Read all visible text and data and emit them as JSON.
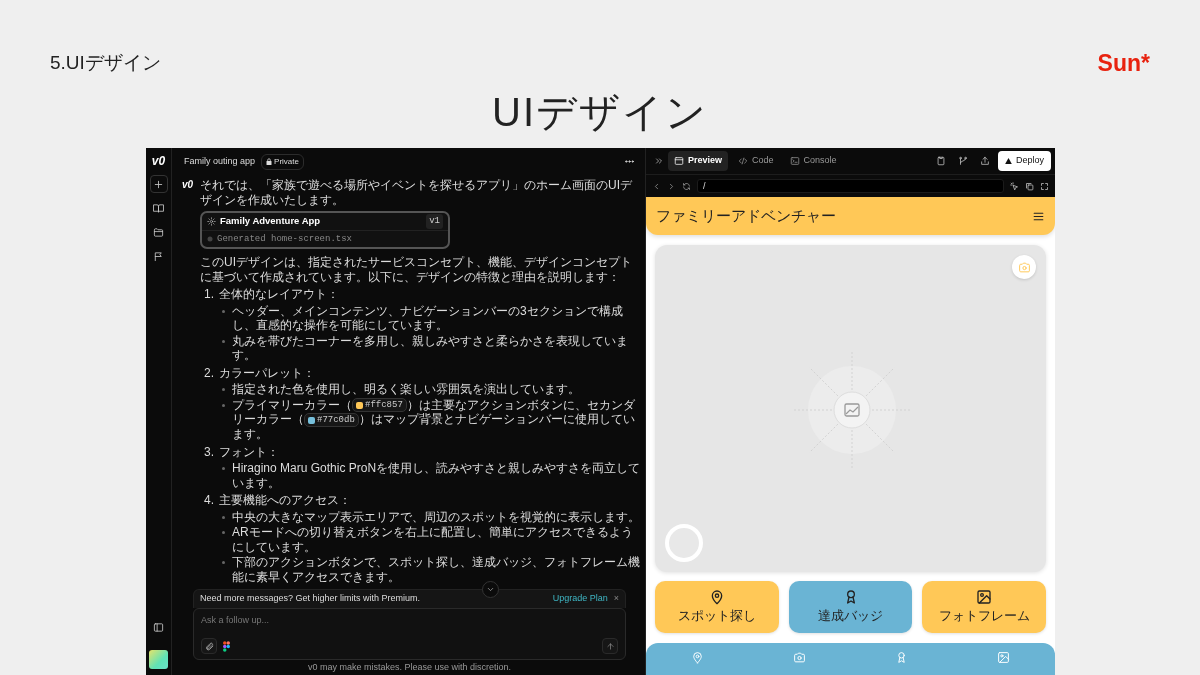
{
  "slide": {
    "section_label": "5.UIデザイン",
    "brand": "Sun*",
    "title": "UIデザイン"
  },
  "chat": {
    "logo": "v0",
    "title": "Family outing app",
    "visibility": "Private",
    "assistant_logo": "v0",
    "intro": "それでは、「家族で遊べる場所やイベントを探せるアプリ」のホーム画面のUIデザインを作成いたします。",
    "artifact": {
      "title": "Family Adventure App",
      "version": "v1",
      "status": "Generated home-screen.tsx"
    },
    "summary": "このUIデザインは、指定されたサービスコンセプト、機能、デザインコンセプトに基づいて作成されています。以下に、デザインの特徴と理由を説明します：",
    "sections": [
      {
        "number": "1.",
        "title": "全体的なレイアウト：",
        "bullets": [
          "ヘッダー、メインコンテンツ、ナビゲーションバーの3セクションで構成し、直感的な操作を可能にしています。",
          "丸みを帯びたコーナーを多用し、親しみやすさと柔らかさを表現しています。"
        ]
      },
      {
        "number": "2.",
        "title": "カラーパレット：",
        "bullets": [
          "指定された色を使用し、明るく楽しい雰囲気を演出しています。",
          [
            {
              "kind": "text",
              "text": "プライマリーカラー（"
            },
            {
              "kind": "swatch",
              "text": "#ffc857",
              "color": "#ffc857"
            },
            {
              "kind": "text",
              "text": "）は主要なアクションボタンに、セカンダリーカラー（"
            },
            {
              "kind": "swatch",
              "text": "#77c0db",
              "color": "#77c0db"
            },
            {
              "kind": "text",
              "text": "）はマップ背景とナビゲーションバーに使用しています。"
            }
          ]
        ]
      },
      {
        "number": "3.",
        "title": "フォント：",
        "bullets": [
          "Hiragino Maru Gothic ProNを使用し、読みやすさと親しみやすさを両立しています。"
        ]
      },
      {
        "number": "4.",
        "title": "主要機能へのアクセス：",
        "bullets": [
          "中央の大きなマップ表示エリアで、周辺のスポットを視覚的に表示します。",
          "ARモードへの切り替えボタンを右上に配置し、簡単にアクセスできるようにしています。",
          "下部のアクションボタンで、スポット探し、達成バッジ、フォトフレーム機能に素早くアクセスできます。"
        ]
      }
    ],
    "banner": {
      "text": "Need more messages? Get higher limits with Premium.",
      "link": "Upgrade Plan",
      "close": "×"
    },
    "composer": {
      "placeholder": "Ask a follow up..."
    },
    "disclaimer": "v0 may make mistakes. Please use with discretion."
  },
  "preview": {
    "tabs": [
      {
        "label": "Preview",
        "kind": "preview",
        "selected": true
      },
      {
        "label": "Code",
        "kind": "code",
        "selected": false
      },
      {
        "label": "Console",
        "kind": "console",
        "selected": false
      }
    ],
    "deploy": "Deploy",
    "address": "/",
    "app": {
      "title": "ファミリーアドベンチャー",
      "actions": [
        {
          "label": "スポット探し",
          "kind": "pin",
          "color": "#ffc857"
        },
        {
          "label": "達成バッジ",
          "kind": "award",
          "color": "#6ab4d4"
        },
        {
          "label": "フォトフレーム",
          "kind": "image",
          "color": "#ffc857"
        }
      ],
      "nav": [
        {
          "kind": "pin"
        },
        {
          "kind": "camera"
        },
        {
          "kind": "award"
        },
        {
          "kind": "image"
        }
      ]
    }
  }
}
